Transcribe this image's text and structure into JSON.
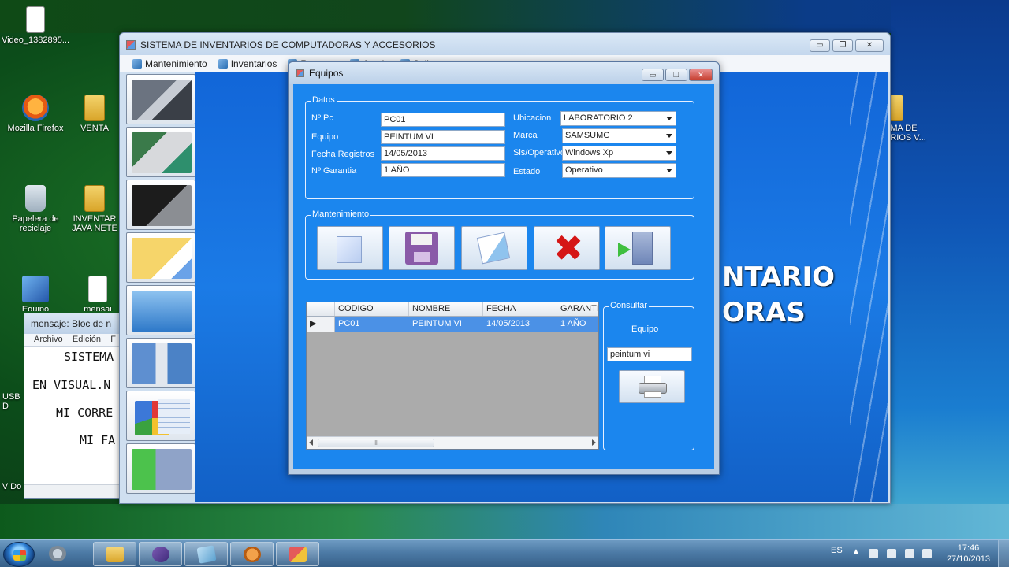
{
  "desktop": {
    "icons": [
      {
        "label": "Video_1382895...",
        "icon": "video-file-icon"
      },
      {
        "label": "Mozilla Firefox",
        "icon": "firefox-icon"
      },
      {
        "label": "VENTA",
        "icon": "folder-icon"
      },
      {
        "label": "Papelera de reciclaje",
        "icon": "recycle-bin-icon"
      },
      {
        "label": "INVENTAR JAVA NETE",
        "icon": "folder-icon"
      },
      {
        "label": "Equipo",
        "icon": "computer-icon"
      },
      {
        "label": "mensaj",
        "icon": "text-file-icon"
      },
      {
        "label": "USB D",
        "icon": "usb-icon"
      },
      {
        "label": "V Do",
        "icon": "file-icon"
      },
      {
        "label": "EMA DE ARIOS V...",
        "icon": "folder-icon"
      }
    ]
  },
  "main_window": {
    "title": "SISTEMA DE INVENTARIOS DE COMPUTADORAS Y ACCESORIOS",
    "menu": [
      "Mantenimiento",
      "Inventarios",
      "Reportes",
      "Ayuda",
      "Salir"
    ],
    "background_text": [
      "NTARIO",
      "ORAS"
    ],
    "sidebar_buttons": [
      {
        "name": "computers",
        "icon": "server-pc-icon"
      },
      {
        "name": "parts",
        "icon": "hardware-parts-icon"
      },
      {
        "name": "desktop",
        "icon": "desktop-pc-icon"
      },
      {
        "name": "clipboard",
        "icon": "clipboard-icon"
      },
      {
        "name": "files",
        "icon": "folder-files-icon"
      },
      {
        "name": "database",
        "icon": "database-lock-icon"
      },
      {
        "name": "reports",
        "icon": "pie-chart-icon"
      },
      {
        "name": "exit",
        "icon": "exit-door-icon"
      }
    ]
  },
  "equipos_dialog": {
    "title": "Equipos",
    "datos": {
      "legend": "Datos",
      "npc_label": "Nº Pc",
      "npc_value": "PC01",
      "equipo_label": "Equipo",
      "equipo_value": "PEINTUM VI",
      "fecha_label": "Fecha Registros",
      "fecha_value": "14/05/2013",
      "garantia_label": "Nº Garantia",
      "garantia_value": "1 AÑO",
      "ubicacion_label": "Ubicacion",
      "ubicacion_value": "LABORATORIO 2",
      "marca_label": "Marca",
      "marca_value": "SAMSUMG",
      "so_label": "Sis/Operativo",
      "so_value": "Windows Xp",
      "estado_label": "Estado",
      "estado_value": "Operativo"
    },
    "mantenimiento": {
      "legend": "Mantenimiento",
      "buttons": [
        {
          "name": "new",
          "icon": "new-document-icon"
        },
        {
          "name": "save",
          "icon": "floppy-disk-icon"
        },
        {
          "name": "edit",
          "icon": "edit-document-icon"
        },
        {
          "name": "delete",
          "icon": "delete-x-icon"
        },
        {
          "name": "exit",
          "icon": "exit-door-icon"
        }
      ]
    },
    "grid": {
      "columns": [
        "CODIGO",
        "NOMBRE",
        "FECHA",
        "GARANTI"
      ],
      "rows": [
        {
          "codigo": "PC01",
          "nombre": "PEINTUM VI",
          "fecha": "14/05/2013",
          "garantia": "1 AÑO"
        }
      ],
      "scroll_grip": "III"
    },
    "consultar": {
      "legend": "Consultar",
      "label": "Equipo",
      "search_value": "peintum vi",
      "print_icon": "printer-icon"
    }
  },
  "notepad": {
    "title": "mensaje: Bloc de n",
    "menu": [
      "Archivo",
      "Edición",
      "F"
    ],
    "lines": [
      "SISTEMA",
      "EN VISUAL.N",
      "MI CORRE",
      "MI FA"
    ]
  },
  "taskbar": {
    "language": "ES",
    "time": "17:46",
    "date": "27/10/2013",
    "apps": [
      "start-orb-icon",
      "shield-icon",
      "explorer-icon",
      "visual-studio-icon",
      "notepad-icon",
      "vlc-icon",
      "app-icon"
    ]
  }
}
